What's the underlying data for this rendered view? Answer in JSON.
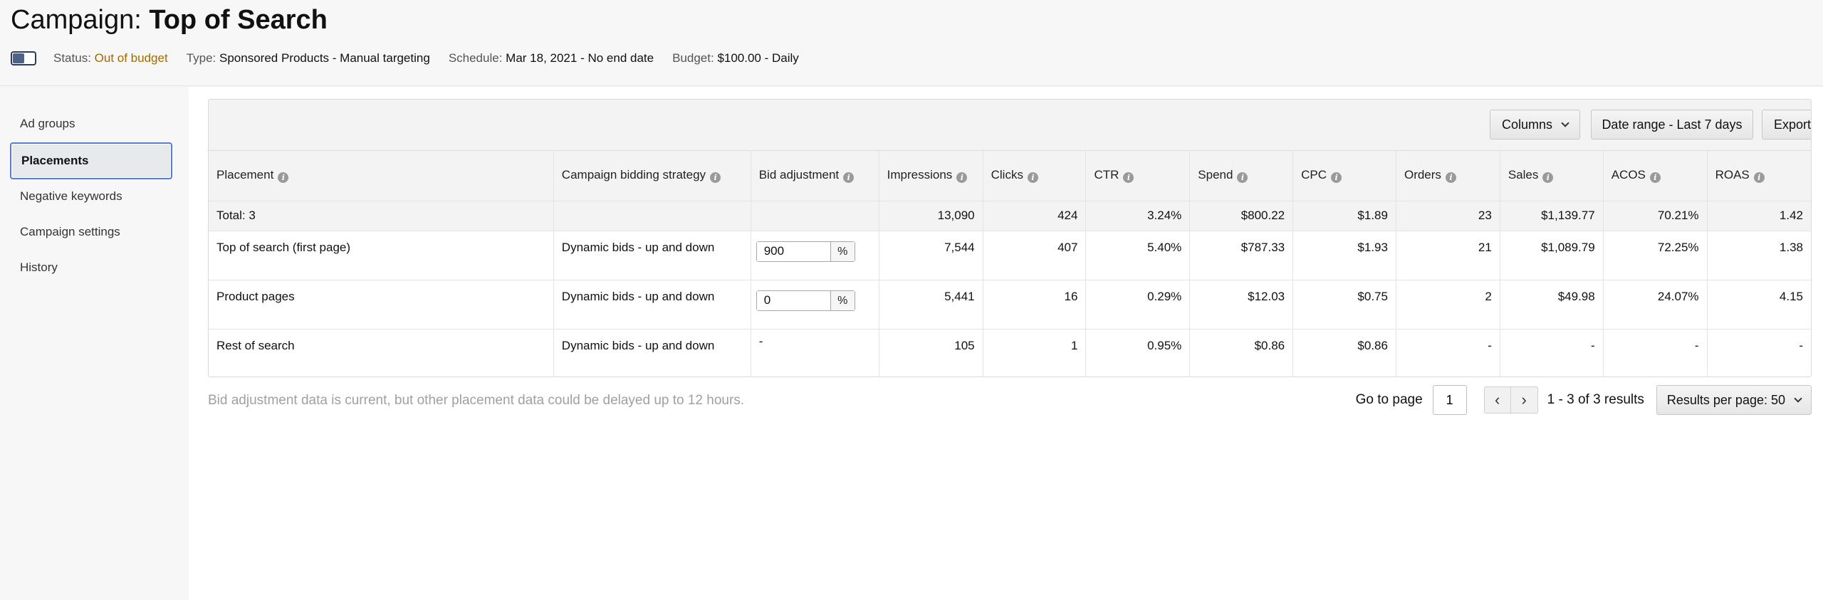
{
  "header": {
    "title_prefix": "Campaign: ",
    "title_name": "Top of Search",
    "status_label": "Status:",
    "status_value": "Out of budget",
    "type_label": "Type:",
    "type_value": "Sponsored Products - Manual targeting",
    "schedule_label": "Schedule:",
    "schedule_value": "Mar 18, 2021 - No end date",
    "budget_label": "Budget:",
    "budget_value": "$100.00 - Daily"
  },
  "sidebar": {
    "items": [
      {
        "label": "Ad groups"
      },
      {
        "label": "Placements"
      },
      {
        "label": "Negative keywords"
      },
      {
        "label": "Campaign settings"
      },
      {
        "label": "History"
      }
    ],
    "active": "Placements"
  },
  "toolbar": {
    "columns_label": "Columns",
    "date_range_label": "Date range - Last 7 days",
    "export_label": "Export"
  },
  "table": {
    "headers": [
      "Placement",
      "Campaign bidding strategy",
      "Bid adjustment",
      "Impressions",
      "Clicks",
      "CTR",
      "Spend",
      "CPC",
      "Orders",
      "Sales",
      "ACOS",
      "ROAS"
    ],
    "total": {
      "placement": "Total: 3",
      "impressions": "13,090",
      "clicks": "424",
      "ctr": "3.24%",
      "spend": "$800.22",
      "cpc": "$1.89",
      "orders": "23",
      "sales": "$1,139.77",
      "acos": "70.21%",
      "roas": "1.42"
    },
    "rows": [
      {
        "placement": "Top of search (first page)",
        "strategy": "Dynamic bids - up and down",
        "bid": "900",
        "impressions": "7,544",
        "clicks": "407",
        "ctr": "5.40%",
        "spend": "$787.33",
        "cpc": "$1.93",
        "orders": "21",
        "sales": "$1,089.79",
        "acos": "72.25%",
        "roas": "1.38"
      },
      {
        "placement": "Product pages",
        "strategy": "Dynamic bids - up and down",
        "bid": "0",
        "impressions": "5,441",
        "clicks": "16",
        "ctr": "0.29%",
        "spend": "$12.03",
        "cpc": "$0.75",
        "orders": "2",
        "sales": "$49.98",
        "acos": "24.07%",
        "roas": "4.15"
      },
      {
        "placement": "Rest of search",
        "strategy": "Dynamic bids - up and down",
        "bid": "-",
        "impressions": "105",
        "clicks": "1",
        "ctr": "0.95%",
        "spend": "$0.86",
        "cpc": "$0.86",
        "orders": "-",
        "sales": "-",
        "acos": "-",
        "roas": "-"
      }
    ],
    "percent_symbol": "%"
  },
  "footer": {
    "note": "Bid adjustment data is current, but other placement data could be delayed up to 12 hours.",
    "goto_label": "Go to page",
    "page_value": "1",
    "results_text": "1 - 3 of 3 results",
    "per_page_label": "Results per page: 50"
  },
  "icons": {
    "info": "i",
    "prev": "‹",
    "next": "›"
  },
  "colors": {
    "status_warning": "#a06a00",
    "active_border": "#5a7ecf",
    "toggle": "#2f3a56"
  }
}
